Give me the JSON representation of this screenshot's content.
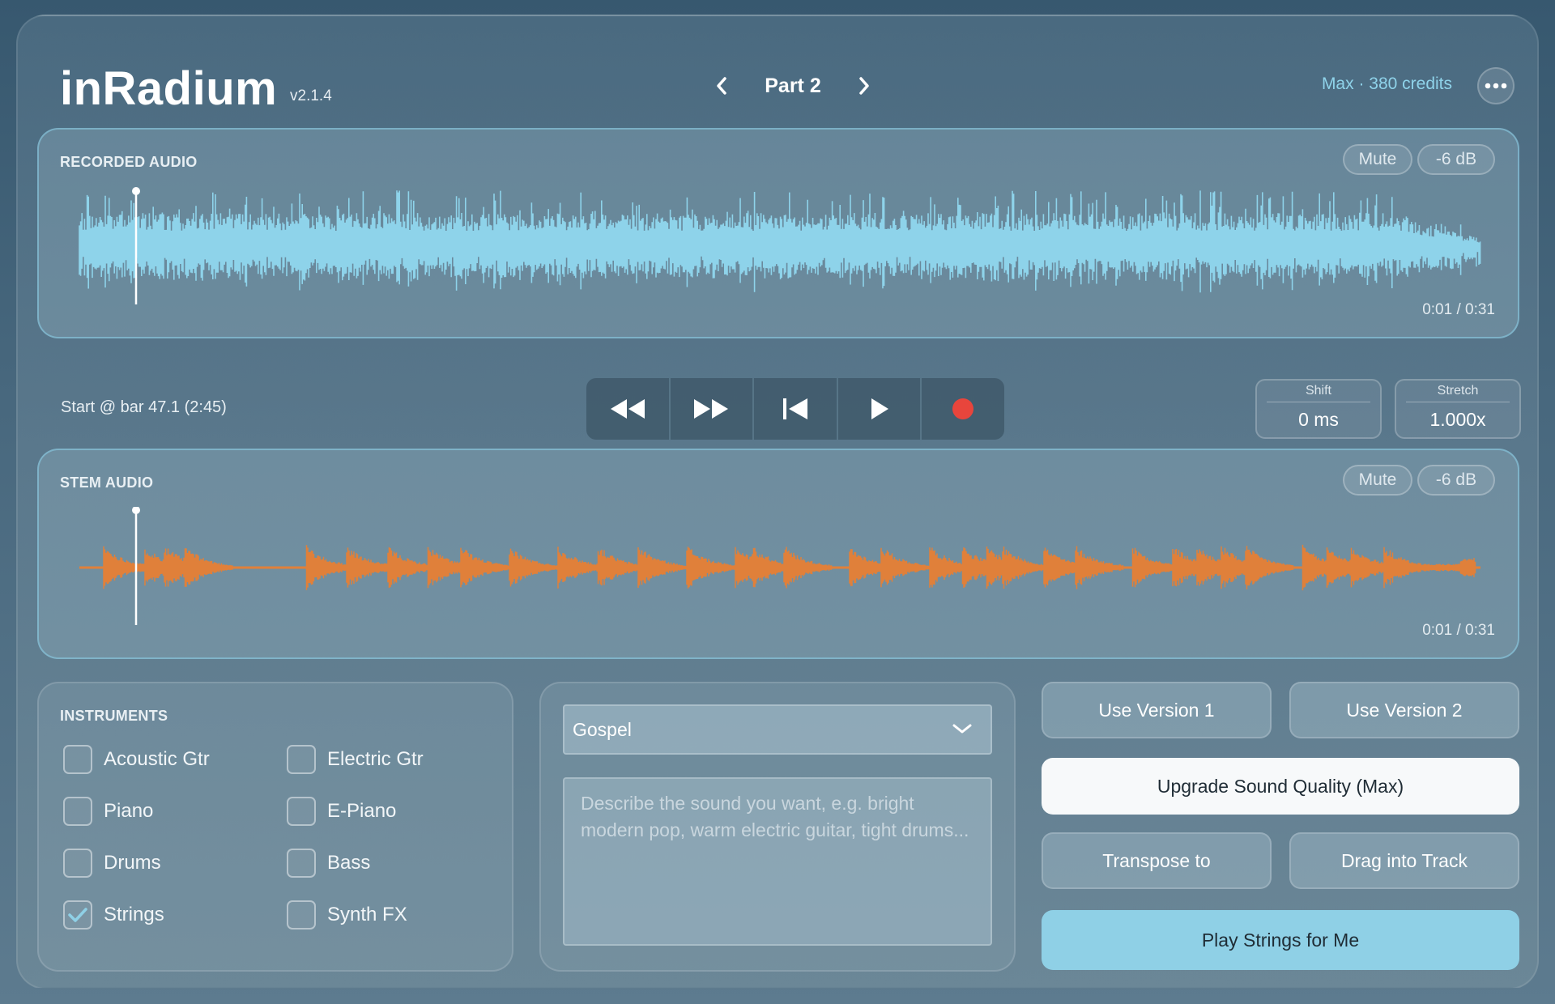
{
  "app": {
    "title": "inRadium",
    "version": "v2.1.4",
    "part_label": "Part 2",
    "credits": "Max · 380 credits"
  },
  "recorded": {
    "label": "RECORDED AUDIO",
    "mute": "Mute",
    "gain": "-6 dB",
    "time": "0:01 / 0:31",
    "wave_color": "#8ed3ea"
  },
  "stem": {
    "label": "STEM AUDIO",
    "mute": "Mute",
    "gain": "-6 dB",
    "time": "0:01 / 0:31",
    "wave_color": "#e0803a"
  },
  "transport": {
    "start_info": "Start @ bar 47.1  (2:45)",
    "record_color": "#e8453c",
    "shift_label": "Shift",
    "shift_value": "0 ms",
    "stretch_label": "Stretch",
    "stretch_value": "1.000x"
  },
  "instruments": {
    "label": "INSTRUMENTS",
    "items": [
      {
        "label": "Acoustic Gtr",
        "checked": false
      },
      {
        "label": "Electric Gtr",
        "checked": false
      },
      {
        "label": "Piano",
        "checked": false
      },
      {
        "label": "E-Piano",
        "checked": false
      },
      {
        "label": "Drums",
        "checked": false
      },
      {
        "label": "Bass",
        "checked": false
      },
      {
        "label": "Strings",
        "checked": true
      },
      {
        "label": "Synth FX",
        "checked": false
      }
    ]
  },
  "prompt": {
    "genre": "Gospel",
    "placeholder": "Describe the sound you want, e.g. bright modern pop, warm electric guitar, tight drums..."
  },
  "actions": {
    "use_v1": "Use Version 1",
    "use_v2": "Use Version 2",
    "upgrade": "Upgrade Sound Quality (Max)",
    "transpose": "Transpose to",
    "drag": "Drag into Track",
    "play": "Play Strings for Me"
  }
}
